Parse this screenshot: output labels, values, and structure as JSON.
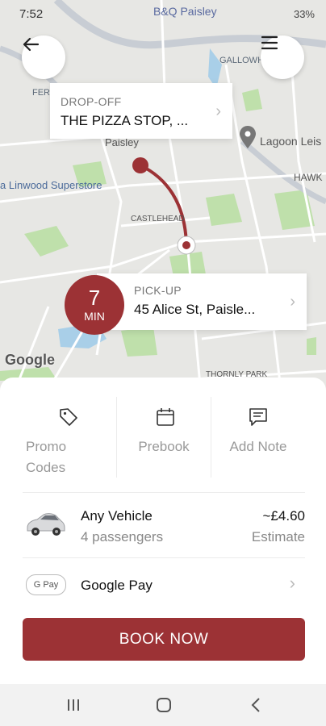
{
  "status": {
    "time": "7:52",
    "battery": "33%"
  },
  "map": {
    "labels": [
      "B&Q Paisley",
      "GALLOWHILL",
      "FERGUS",
      "Paisley",
      "a Linwood Superstore",
      "Lagoon Leis",
      "HAWK",
      "CASTLEHEAD",
      "THORNLY PARK"
    ],
    "attribution": "Google"
  },
  "dropoff": {
    "caption": "DROP-OFF",
    "value": "THE PIZZA STOP, ..."
  },
  "pickup": {
    "caption": "PICK-UP",
    "value": "45 Alice St, Paisle..."
  },
  "eta": {
    "value": "7",
    "unit": "MIN"
  },
  "actions": {
    "promo": {
      "line1": "Promo",
      "line2": "Codes"
    },
    "prebook": "Prebook",
    "note": "Add Note"
  },
  "vehicle": {
    "name": "Any Vehicle",
    "capacity": "4 passengers",
    "price": "~£4.60",
    "price_note": "Estimate"
  },
  "payment": {
    "badge": "G Pay",
    "label": "Google Pay"
  },
  "book_button": "BOOK NOW",
  "colors": {
    "accent": "#9c3235",
    "route": "#9c3235",
    "map_green": "#b9dfa6"
  },
  "icons": [
    "back-arrow-icon",
    "menu-icon",
    "tag-icon",
    "calendar-icon",
    "note-icon",
    "car-icon",
    "chevron-right-icon",
    "map-pin-icon"
  ]
}
